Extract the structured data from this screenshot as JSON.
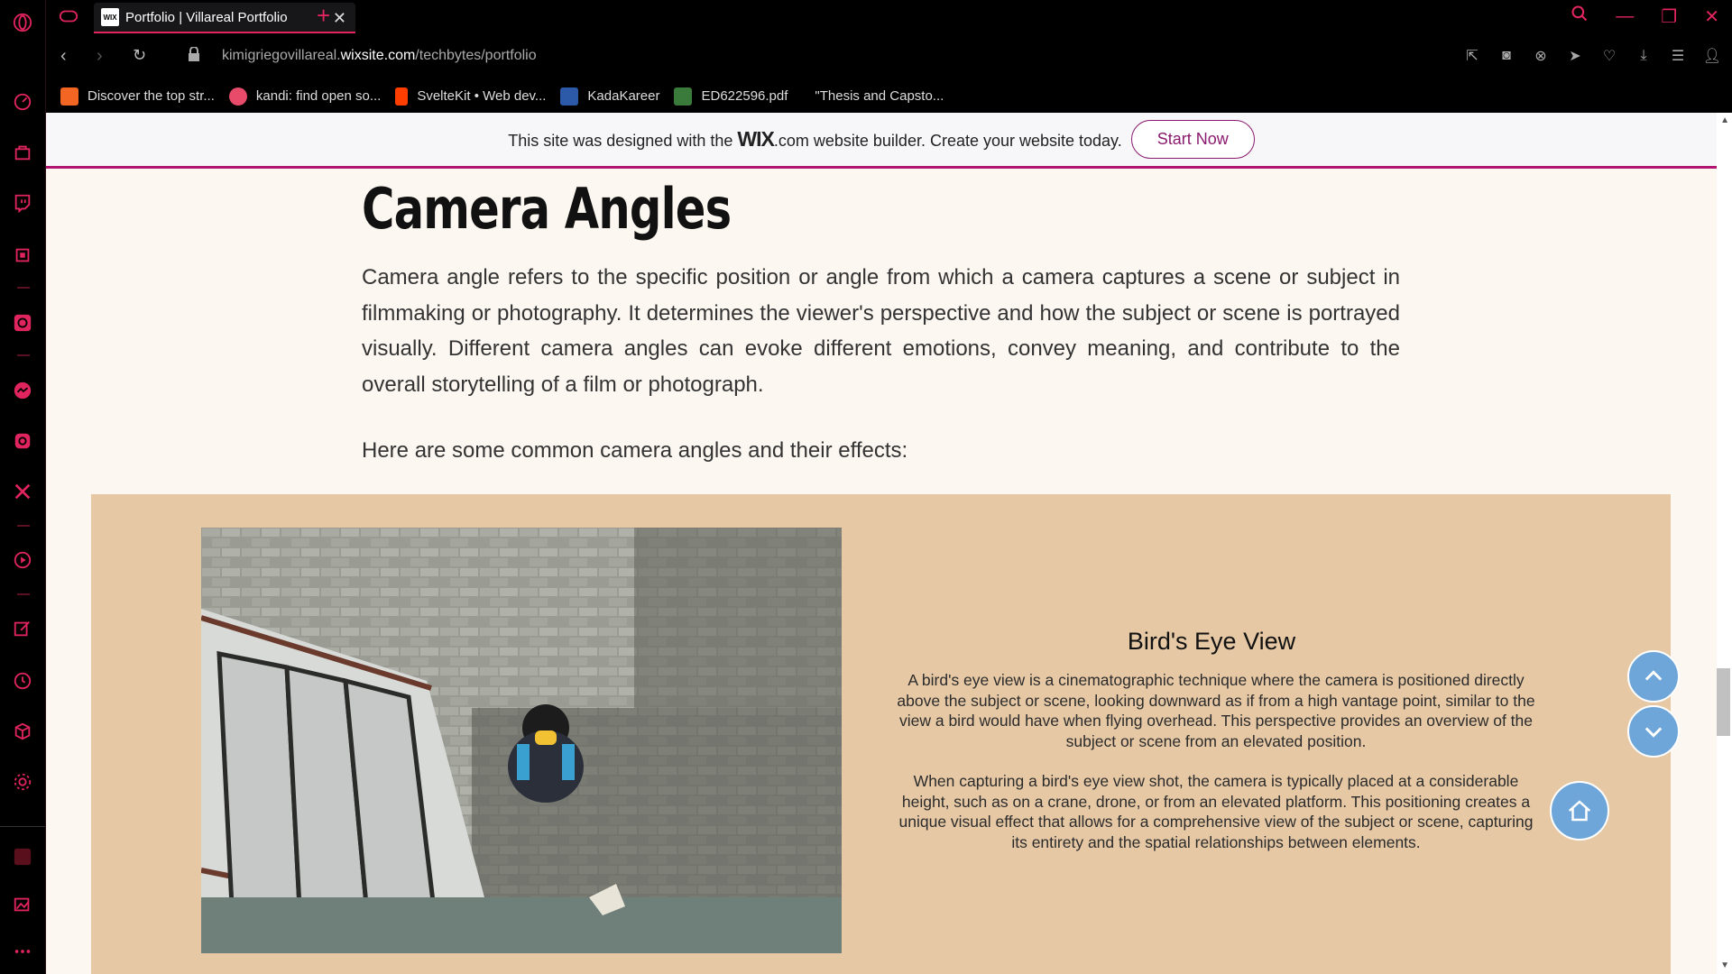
{
  "browser": {
    "tab_title": "Portfolio | Villareal Portfolio",
    "tab_favicon": "WIX",
    "url_prefix": "kimigriegovillareal.",
    "url_domain": "wixsite.com",
    "url_path": "/techbytes/portfolio",
    "accent": "#e0245e"
  },
  "bookmarks": [
    {
      "label": "Discover the top str...",
      "color": "#f26522"
    },
    {
      "label": "kandi: find open so...",
      "color": "#e84a6a"
    },
    {
      "label": "SvelteKit • Web dev...",
      "color": "#ff3e00"
    },
    {
      "label": "KadaKareer",
      "color": "#2d5aa8"
    },
    {
      "label": "ED622596.pdf",
      "color": "#3a7a3a"
    },
    {
      "label": "\"Thesis and Capsto...",
      "color": "#000000"
    }
  ],
  "wix_banner": {
    "text_before": "This site was designed with the",
    "logo": "WIX",
    "logo_suffix": ".com",
    "text_after": "website builder. Create your website today.",
    "button": "Start Now"
  },
  "content": {
    "heading": "Camera Angles",
    "intro": "Camera angle refers to the specific position or angle from which a camera captures a scene or subject in filmmaking or photography. It determines the viewer's perspective and how the subject or scene is portrayed visually. Different camera angles can evoke different emotions, convey meaning, and contribute to the overall storytelling of a film or photograph.",
    "sub": "Here are some common camera angles and their effects:"
  },
  "card": {
    "title": "Bird's Eye View",
    "p1": "A bird's eye view is a cinematographic technique where the camera is positioned directly above the subject or scene, looking downward as if from a high vantage point, similar to the view a bird would have when flying overhead. This perspective provides an overview of the subject or scene from an elevated position.",
    "p2": "When capturing a bird's eye view shot, the camera is typically placed at a considerable height, such as on a crane, drone, or from an elevated platform. This positioning creates a unique visual effect that allows for a comprehensive view of the subject or scene, capturing its entirety and the spatial relationships between elements."
  }
}
